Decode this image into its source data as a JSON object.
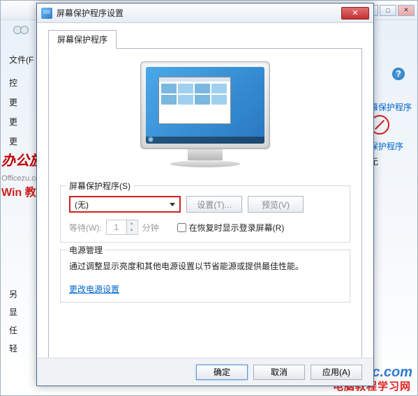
{
  "bg": {
    "menu_file": "文件(F",
    "left_items": [
      "控",
      "更",
      "更",
      "更"
    ],
    "side_low": [
      "另",
      "显",
      "任",
      "轻"
    ],
    "right_link": "幕保护程序",
    "right_prog": "保护程序",
    "right_none": "无"
  },
  "watermarks": {
    "w1_main": "办公族",
    "w1_sub": "Officezu.com",
    "w1_win": "Win 教程",
    "w2": "Windowsjc.com",
    "w3": "电脑教程学习网"
  },
  "dialog": {
    "title": "屏幕保护程序设置",
    "tab": "屏幕保护程序",
    "group1_label": "屏幕保护程序(S)",
    "combo_value": "(无)",
    "btn_settings": "设置(T)...",
    "btn_preview": "预览(V)",
    "wait_label": "等待(W):",
    "wait_value": "1",
    "wait_unit": "分钟",
    "resume_label": "在恢复时显示登录屏幕(R)",
    "group2_label": "电源管理",
    "power_text": "通过调整显示亮度和其他电源设置以节省能源或提供最佳性能。",
    "power_link": "更改电源设置",
    "btn_ok": "确定",
    "btn_cancel": "取消",
    "btn_apply": "应用(A)"
  }
}
